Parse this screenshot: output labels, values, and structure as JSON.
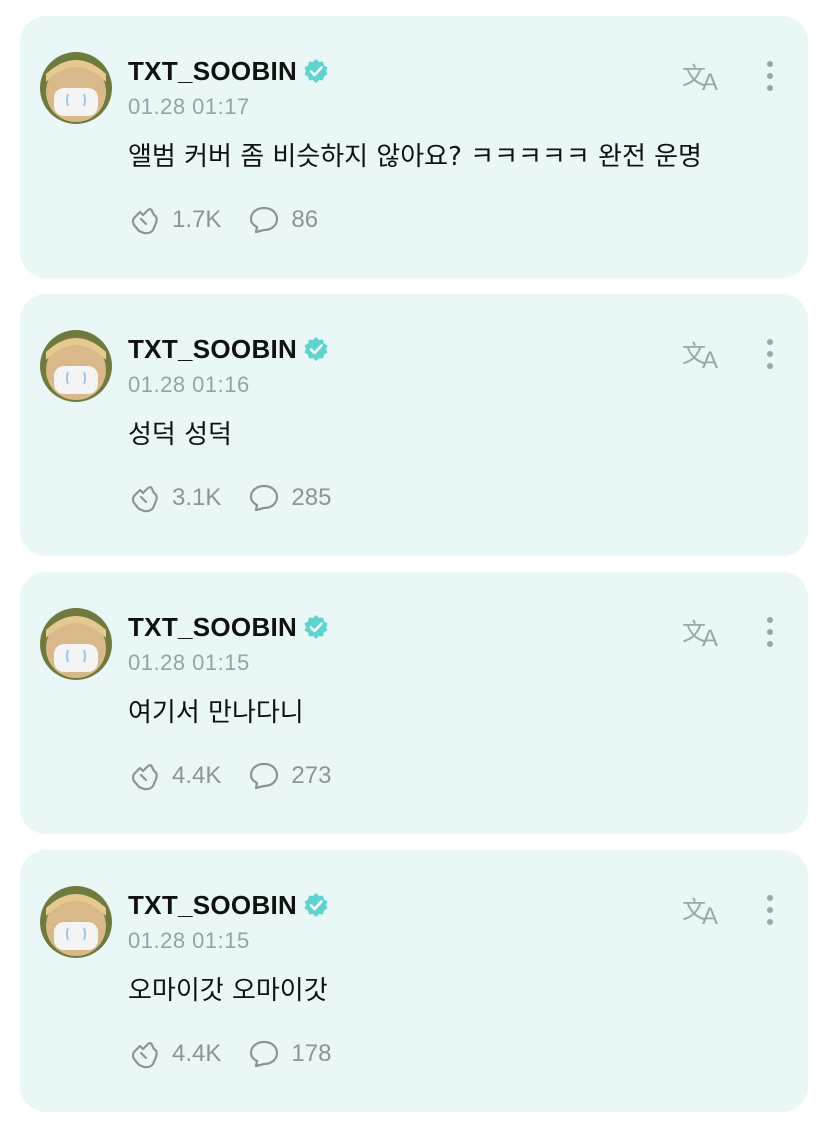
{
  "posts": [
    {
      "username": "TXT_SOOBIN",
      "timestamp": "01.28 01:17",
      "text": "앨범 커버 좀 비슷하지 않아요? ㅋㅋㅋㅋㅋ 완전 운명",
      "likes": "1.7K",
      "comments": "86"
    },
    {
      "username": "TXT_SOOBIN",
      "timestamp": "01.28 01:16",
      "text": "성덕 성덕",
      "likes": "3.1K",
      "comments": "285"
    },
    {
      "username": "TXT_SOOBIN",
      "timestamp": "01.28 01:15",
      "text": "여기서 만나다니",
      "likes": "4.4K",
      "comments": "273"
    },
    {
      "username": "TXT_SOOBIN",
      "timestamp": "01.28 01:15",
      "text": "오마이갓 오마이갓",
      "likes": "4.4K",
      "comments": "178"
    }
  ],
  "icons": {
    "verified": "verified-badge-icon",
    "translate": "translate-icon",
    "more": "more-vertical-icon",
    "like": "cheer-hand-icon",
    "comment": "comment-bubble-icon"
  },
  "colors": {
    "card_background": "#e9f8f6",
    "verified_badge": "#5fd3cf",
    "meta_text": "#8fa7a4"
  }
}
